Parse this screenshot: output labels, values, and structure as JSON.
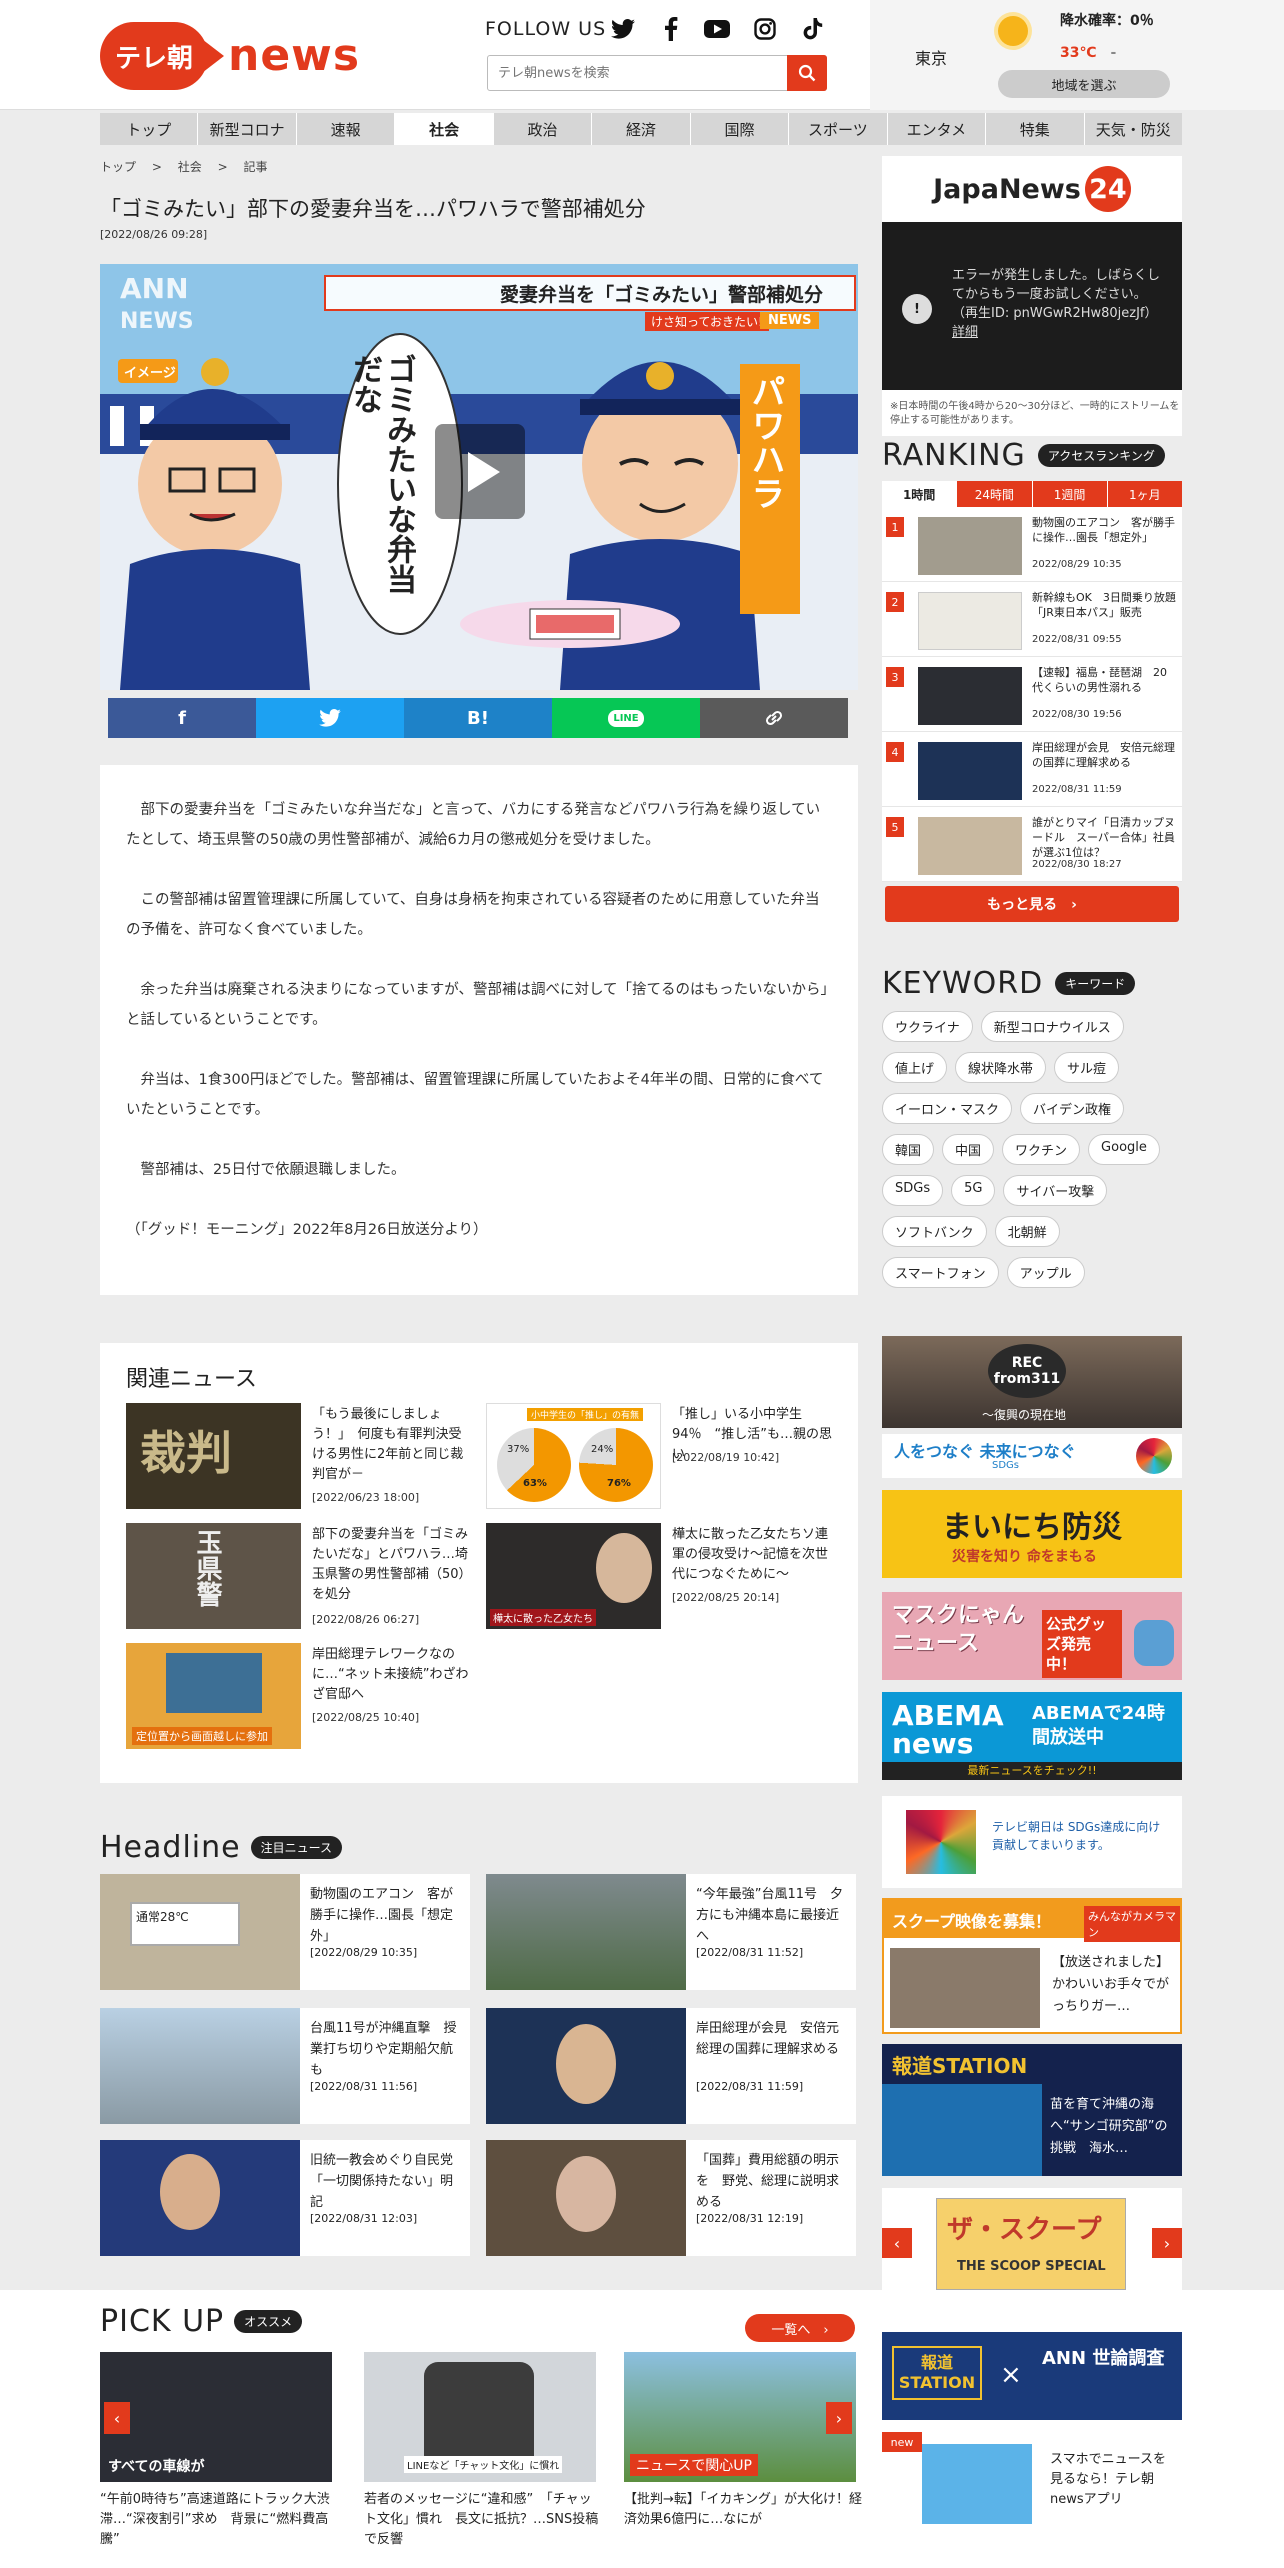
{
  "header": {
    "logo_jp": "テレ朝",
    "logo_en": "news",
    "follow": "FOLLOW US",
    "search_placeholder": "テレ朝newsを検索",
    "weather": {
      "city": "東京",
      "rain": "降水確率：0％",
      "temp": "33℃",
      "temp_low": "-",
      "area_button": "地域を選ぶ"
    }
  },
  "nav": [
    "トップ",
    "新型コロナ",
    "速報",
    "社会",
    "政治",
    "経済",
    "国際",
    "スポーツ",
    "エンタメ",
    "特集",
    "天気・防災"
  ],
  "breadcrumb": [
    "トップ",
    "社会",
    "記事"
  ],
  "article": {
    "title": "「ゴミみたい」部下の愛妻弁当を…パワハラで警部補処分",
    "date": "[2022/08/26 09:28]",
    "video": {
      "ann": "ANN",
      "news": "NEWS",
      "image_label": "イメージ",
      "headline": "愛妻弁当を「ゴミみたい」警部補処分",
      "sub": "けさ知っておきたい!",
      "sub_tag": "NEWS",
      "bubble": "ゴミみたいな弁当だな",
      "sign": "パワハラ"
    },
    "share": [
      "f",
      "twitter",
      "B!",
      "LINE",
      "link"
    ],
    "paragraphs": [
      "部下の愛妻弁当を「ゴミみたいな弁当だな」と言って、バカにする発言などパワハラ行為を繰り返していたとして、埼玉県警の50歳の男性警部補が、減給6カ月の懲戒処分を受けました。",
      "この警部補は留置管理課に所属していて、自身は身柄を拘束されている容疑者のために用意していた弁当の予備を、許可なく食べていました。",
      "余った弁当は廃棄される決まりになっていますが、警部補は調べに対して「捨てるのはもったいないから」と話しているということです。",
      "弁当は、1食300円ほどでした。警部補は、留置管理課に所属していたおよそ4年半の間、日常的に食べていたということです。",
      "警部補は、25日付で依願退職しました。",
      "（「グッド！モーニング」2022年8月26日放送分より）"
    ]
  },
  "related": {
    "heading": "関連ニュース",
    "items": [
      {
        "title": "「もう最後にしましょう！」　何度も有罪判決受ける男性に2年前と同じ裁判官が－",
        "date": "[2022/06/23 18:00]"
      },
      {
        "title": "「推し」いる小中学生94％　“推し活”も…親の思い",
        "date": "[2022/08/19 10:42]"
      },
      {
        "title": "部下の愛妻弁当を「ゴミみたいだな」とパワハラ…埼玉県警の男性警部補（50）を処分",
        "date": "[2022/08/26 06:27]"
      },
      {
        "title": "樺太に散った乙女たちソ連軍の侵攻受け～記憶を次世代につなぐために～",
        "date": "[2022/08/25 20:14]"
      },
      {
        "title": "岸田総理テレワークなのに…“ネット未接続”わざわざ官邸へ",
        "date": "[2022/08/25 10:40]"
      }
    ],
    "thumb_text": {
      "court": "裁判",
      "pie_title": "小中学生の「推し」の有無",
      "pie_a": "63%",
      "pie_b": "76%",
      "pie_c": "37%",
      "pie_d": "24%",
      "police": "玉県警",
      "war": "樺太に散った乙女たち",
      "kishida": "定位置から画面越しに参加"
    }
  },
  "headline": {
    "heading": "Headline",
    "tag": "注目ニュース",
    "items": [
      {
        "title": "動物園のエアコン　客が勝手に操作…園長「想定外」",
        "date": "[2022/08/29 10:35]"
      },
      {
        "title": "“今年最強”台風11号　夕方にも沖縄本島に最接近へ",
        "date": "[2022/08/31 11:52]"
      },
      {
        "title": "台風11号が沖縄直撃　授業打ち切りや定期船欠航も",
        "date": "[2022/08/31 11:56]"
      },
      {
        "title": "岸田総理が会見　安倍元総理の国葬に理解求める",
        "date": "[2022/08/31 11:59]"
      },
      {
        "title": "旧統一教会めぐり自民党「一切関係持たない」明記",
        "date": "[2022/08/31 12:03]"
      },
      {
        "title": "「国葬」費用総額の明示を　野党、総理に説明求める",
        "date": "[2022/08/31 12:19]"
      }
    ],
    "thumb_text": {
      "ac": "通常28℃"
    }
  },
  "pickup": {
    "heading": "PICK UP",
    "tag": "オススメ",
    "list_button": "一覧へ",
    "items": [
      {
        "title": "“午前0時待ち”高速道路にトラック大渋滞…“深夜割引”求め　背景に“燃料費高騰”",
        "thumb_caption": "すべての車線が"
      },
      {
        "title": "若者のメッセージに“違和感”　「チャット文化」慣れ　長文に抵抗？…SNS投稿で反響",
        "thumb_caption": "LINEなど「チャット文化」に慣れ"
      },
      {
        "title": "【批判→転】「イカキング」が大化け！経済効果6億円に…なにが",
        "thumb_caption": "ニュースで関心UP"
      }
    ]
  },
  "sidebar": {
    "japanews": {
      "logo": "JapaNews",
      "logo_num": "24",
      "error": "エラーが発生しました。しばらくしてからもう一度お試しください。（再生ID: pnWGwR2Hw80jezJf）",
      "detail": "詳細",
      "note": "※日本時間の午後4時から20～30分ほど、一時的にストリームを停止する可能性があります。"
    },
    "ranking": {
      "heading": "RANKING",
      "tag": "アクセスランキング",
      "tabs": [
        "1時間",
        "24時間",
        "1週間",
        "1ヶ月"
      ],
      "items": [
        {
          "n": "1",
          "title": "動物園のエアコン　客が勝手に操作…園長「想定外」",
          "date": "2022/08/29 10:35"
        },
        {
          "n": "2",
          "title": "新幹線もOK　3日間乗り放題　「JR東日本パス」販売",
          "date": "2022/08/31 09:55"
        },
        {
          "n": "3",
          "title": "【速報】福島・琵琶湖　20代くらいの男性溺れる",
          "date": "2022/08/30 19:56"
        },
        {
          "n": "4",
          "title": "岸田総理が会見　安倍元総理の国葬に理解求める",
          "date": "2022/08/31 11:59"
        },
        {
          "n": "5",
          "title": "誰がとりマイ「日清カップヌードル　スーパー合体」社員が選ぶ1位は？",
          "date": "2022/08/30 18:27"
        }
      ],
      "more": "もっと見る"
    },
    "keyword": {
      "heading": "KEYWORD",
      "tag": "キーワード",
      "chips": [
        "ウクライナ",
        "新型コロナウイルス",
        "値上げ",
        "線状降水帯",
        "サル痘",
        "イーロン・マスク",
        "バイデン政権",
        "韓国",
        "中国",
        "ワクチン",
        "Google",
        "SDGs",
        "5G",
        "サイバー攻撃",
        "ソフトバンク",
        "北朝鮮",
        "スマートフォン",
        "アップル"
      ]
    },
    "banners": {
      "rec": "REC",
      "rec_sub": "from311",
      "rec_cap": "～復興の現在地",
      "sdgs": "人をつなぐ 未来につなぐ",
      "sdgs_sub": "SDGs",
      "bousai": "まいにち防災",
      "bousai_sub": "災害を知り 命をまもる",
      "mask": "マスクにゃん ニュース",
      "mask_sub": "公式グッズ発売中！",
      "abema": "ABEMA news",
      "abema_r": "ABEMAで24時間放送中",
      "abema_sub": "最新ニュースをチェック!!",
      "sdgs2": "テレビ朝日は SDGs達成に向け 貢献してまいります。",
      "scoop": "スクープ映像を募集！",
      "scoop_tag": "みんながカメラマン",
      "scoop_text": "【放送されました】かわいいお手々でがっちりガー…",
      "hodo": "報道STATION",
      "hodo_text": "苗を育て沖縄の海へ“サンゴ研究部”の挑戦　海水…",
      "zaskoop": "ザ・スクープ",
      "zaskoop_sub": "THE SCOOP SPECIAL",
      "poll_a": "報道 STATION",
      "poll_b": "ANN 世論調査",
      "app": "スマホでニュースを見るなら！テレ朝newsアプリ",
      "app_tag": "new"
    }
  },
  "colors": {
    "brand": "#e23a1c",
    "fb": "#3b5998",
    "tw": "#1da1f2",
    "hatena": "#1e82c8",
    "line": "#06c755",
    "link": "#5a5a5a"
  }
}
